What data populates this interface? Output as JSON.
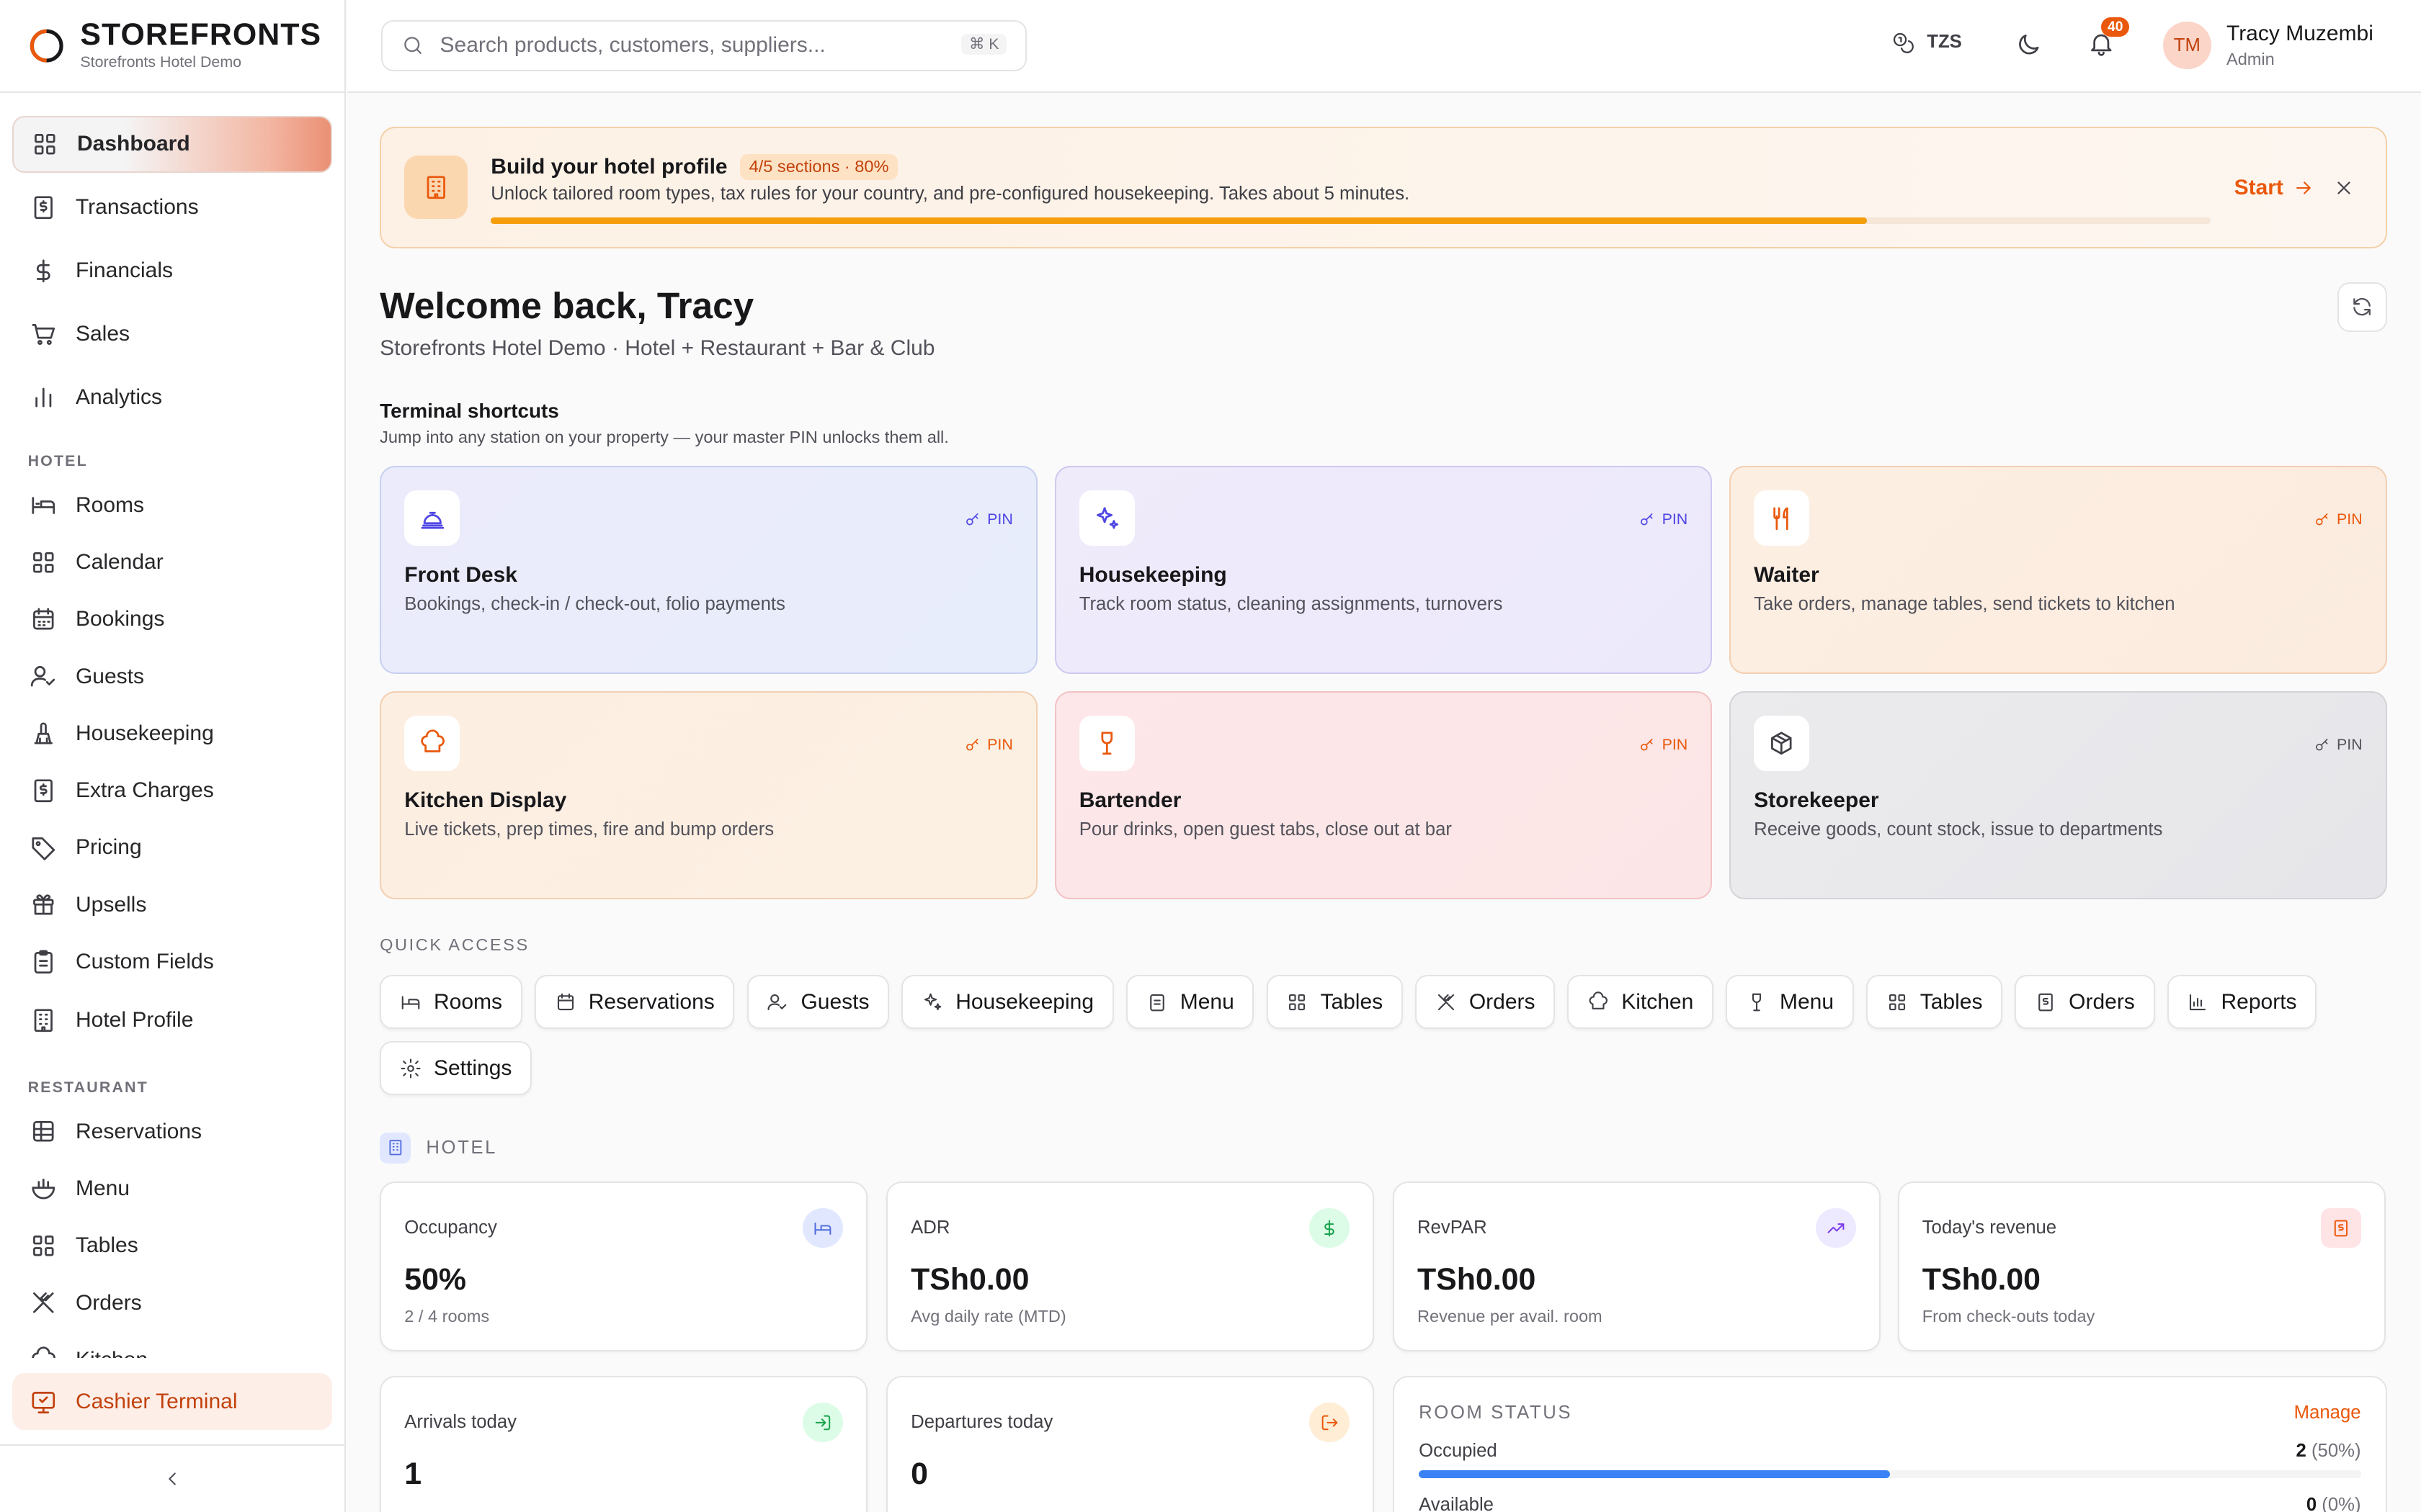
{
  "brand": {
    "name": "STOREFRONTS",
    "subtitle": "Storefronts Hotel Demo"
  },
  "sidebar": {
    "main": [
      {
        "label": "Dashboard",
        "icon": "dashboard-icon",
        "active": true
      },
      {
        "label": "Transactions",
        "icon": "receipt-icon"
      },
      {
        "label": "Financials",
        "icon": "dollar-icon"
      },
      {
        "label": "Sales",
        "icon": "cart-icon"
      },
      {
        "label": "Analytics",
        "icon": "bar-chart-icon"
      }
    ],
    "hotel_label": "HOTEL",
    "hotel": [
      {
        "label": "Rooms",
        "icon": "bed-icon"
      },
      {
        "label": "Calendar",
        "icon": "grid-icon"
      },
      {
        "label": "Bookings",
        "icon": "calendar-icon"
      },
      {
        "label": "Guests",
        "icon": "user-check-icon"
      },
      {
        "label": "Housekeeping",
        "icon": "broom-icon"
      },
      {
        "label": "Extra Charges",
        "icon": "receipt-icon"
      },
      {
        "label": "Pricing",
        "icon": "tag-icon"
      },
      {
        "label": "Upsells",
        "icon": "gift-icon"
      },
      {
        "label": "Custom Fields",
        "icon": "clipboard-icon"
      },
      {
        "label": "Hotel Profile",
        "icon": "building-icon"
      }
    ],
    "restaurant_label": "RESTAURANT",
    "restaurant": [
      {
        "label": "Reservations",
        "icon": "table-icon"
      },
      {
        "label": "Menu",
        "icon": "bowl-icon"
      },
      {
        "label": "Tables",
        "icon": "grid-icon"
      },
      {
        "label": "Orders",
        "icon": "utensils-cross-icon"
      },
      {
        "label": "Kitchen",
        "icon": "chef-hat-icon"
      }
    ],
    "cashier": "Cashier Terminal"
  },
  "topbar": {
    "search_placeholder": "Search products, customers, suppliers...",
    "shortcut": "⌘ K",
    "currency": "TZS",
    "notifications": "40",
    "user_initials": "TM",
    "user_name": "Tracy Muzembi",
    "user_role": "Admin"
  },
  "banner": {
    "title": "Build your hotel profile",
    "pill": "4/5 sections · 80%",
    "subtitle": "Unlock tailored room types, tax rules for your country, and pre-configured housekeeping. Takes about 5 minutes.",
    "progress": 0.8,
    "start": "Start"
  },
  "welcome": {
    "title": "Welcome back, Tracy",
    "subtitle": "Storefronts Hotel Demo · Hotel + Restaurant + Bar & Club"
  },
  "shortcuts": {
    "title": "Terminal shortcuts",
    "subtitle": "Jump into any station on your property — your master PIN unlocks them all.",
    "pin_label": "PIN",
    "cards": [
      {
        "name": "Front Desk",
        "desc": "Bookings, check-in / check-out, folio payments",
        "icon": "bell-service-icon"
      },
      {
        "name": "Housekeeping",
        "desc": "Track room status, cleaning assignments, turnovers",
        "icon": "sparkles-icon"
      },
      {
        "name": "Waiter",
        "desc": "Take orders, manage tables, send tickets to kitchen",
        "icon": "utensils-icon"
      },
      {
        "name": "Kitchen Display",
        "desc": "Live tickets, prep times, fire and bump orders",
        "icon": "chef-hat-icon"
      },
      {
        "name": "Bartender",
        "desc": "Pour drinks, open guest tabs, close out at bar",
        "icon": "wine-icon"
      },
      {
        "name": "Storekeeper",
        "desc": "Receive goods, count stock, issue to departments",
        "icon": "package-icon"
      }
    ]
  },
  "quick_access": {
    "label": "QUICK ACCESS",
    "items": [
      "Rooms",
      "Reservations",
      "Guests",
      "Housekeeping",
      "Menu",
      "Tables",
      "Orders",
      "Kitchen",
      "Menu",
      "Tables",
      "Orders",
      "Reports",
      "Settings"
    ]
  },
  "hotel_section": "HOTEL",
  "stats": [
    {
      "label": "Occupancy",
      "value": "50%",
      "sub": "2 / 4 rooms",
      "icon": "bed-icon"
    },
    {
      "label": "ADR",
      "value": "TSh0.00",
      "sub": "Avg daily rate (MTD)",
      "icon": "dollar-icon"
    },
    {
      "label": "RevPAR",
      "value": "TSh0.00",
      "sub": "Revenue per avail. room",
      "icon": "trend-up-icon"
    },
    {
      "label": "Today's revenue",
      "value": "TSh0.00",
      "sub": "From check-outs today",
      "icon": "receipt-icon"
    },
    {
      "label": "Arrivals today",
      "value": "1",
      "icon": "log-in-icon"
    },
    {
      "label": "Departures today",
      "value": "0",
      "icon": "log-out-icon"
    }
  ],
  "room_status": {
    "title": "ROOM STATUS",
    "manage": "Manage",
    "rows": [
      {
        "label": "Occupied",
        "count": "2",
        "pct": "(50%)",
        "value": 0.5
      },
      {
        "label": "Available",
        "count": "0",
        "pct": "(0%)",
        "value": 0
      }
    ]
  }
}
